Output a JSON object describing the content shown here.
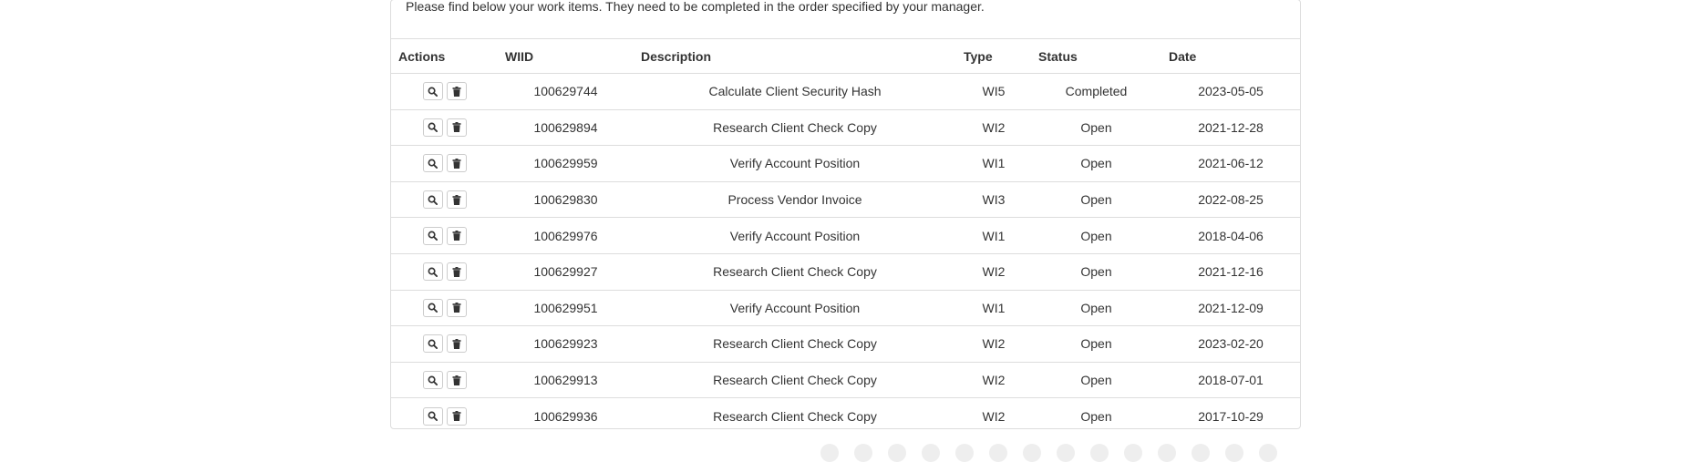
{
  "intro_text": "Please find below your work items. They need to be completed in the order specified by your manager.",
  "table": {
    "headers": {
      "actions": "Actions",
      "wiid": "WIID",
      "description": "Description",
      "type": "Type",
      "status": "Status",
      "date": "Date"
    },
    "rows": [
      {
        "wiid": "100629744",
        "description": "Calculate Client Security Hash",
        "type": "WI5",
        "status": "Completed",
        "date": "2023-05-05"
      },
      {
        "wiid": "100629894",
        "description": "Research Client Check Copy",
        "type": "WI2",
        "status": "Open",
        "date": "2021-12-28"
      },
      {
        "wiid": "100629959",
        "description": "Verify Account Position",
        "type": "WI1",
        "status": "Open",
        "date": "2021-06-12"
      },
      {
        "wiid": "100629830",
        "description": "Process Vendor Invoice",
        "type": "WI3",
        "status": "Open",
        "date": "2022-08-25"
      },
      {
        "wiid": "100629976",
        "description": "Verify Account Position",
        "type": "WI1",
        "status": "Open",
        "date": "2018-04-06"
      },
      {
        "wiid": "100629927",
        "description": "Research Client Check Copy",
        "type": "WI2",
        "status": "Open",
        "date": "2021-12-16"
      },
      {
        "wiid": "100629951",
        "description": "Verify Account Position",
        "type": "WI1",
        "status": "Open",
        "date": "2021-12-09"
      },
      {
        "wiid": "100629923",
        "description": "Research Client Check Copy",
        "type": "WI2",
        "status": "Open",
        "date": "2023-02-20"
      },
      {
        "wiid": "100629913",
        "description": "Research Client Check Copy",
        "type": "WI2",
        "status": "Open",
        "date": "2018-07-01"
      },
      {
        "wiid": "100629936",
        "description": "Research Client Check Copy",
        "type": "WI2",
        "status": "Open",
        "date": "2017-10-29"
      }
    ],
    "row_actions": {
      "view_icon": "search-icon",
      "delete_icon": "trash-icon"
    }
  },
  "colors": {
    "border": "#dddddd",
    "text": "#333333",
    "icon": "#333333"
  }
}
